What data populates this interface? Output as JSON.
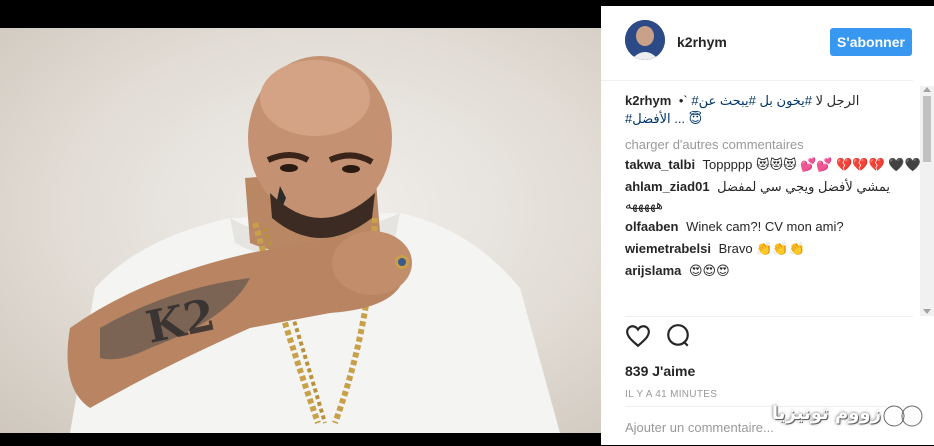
{
  "post": {
    "username": "k2rhym",
    "follow_label": "S'abonner",
    "caption_user": "k2rhym",
    "caption_lines": [
      "#الرجل لا #يخون بل #يبحث عن",
      "الأفضل# ... 😇"
    ],
    "caption_tags": [
      {
        "text": "الرجل لا",
        "tag": false
      },
      {
        "text": "#يخون بل",
        "tag": true
      },
      {
        "text": "#يبحث عن#",
        "tag": true
      }
    ],
    "caption_line2": "#الأفضل ... 😇",
    "load_more": "charger d'autres commentaires",
    "comments": [
      {
        "user": "takwa_talbi",
        "text": "Toppppp 😻😻😻 💕💕 💔💔💔 🖤🖤"
      },
      {
        "user": "ahlam_ziad01",
        "text": "يمشي لأفضل ويجي سي لمفضل هههههه"
      },
      {
        "user": "olfaaben",
        "text": "Winek cam?! CV mon ami?"
      },
      {
        "user": "wiemetrabelsi",
        "text": "Bravo 👏👏👏"
      },
      {
        "user": "arijslama",
        "text": "😍😍😍"
      }
    ],
    "likes": "839 J'aime",
    "time": "IL Y A 41 MINUTES",
    "comment_placeholder": "Ajouter un commentaire..."
  },
  "watermark": {
    "text": "زووم تونيزيا"
  }
}
